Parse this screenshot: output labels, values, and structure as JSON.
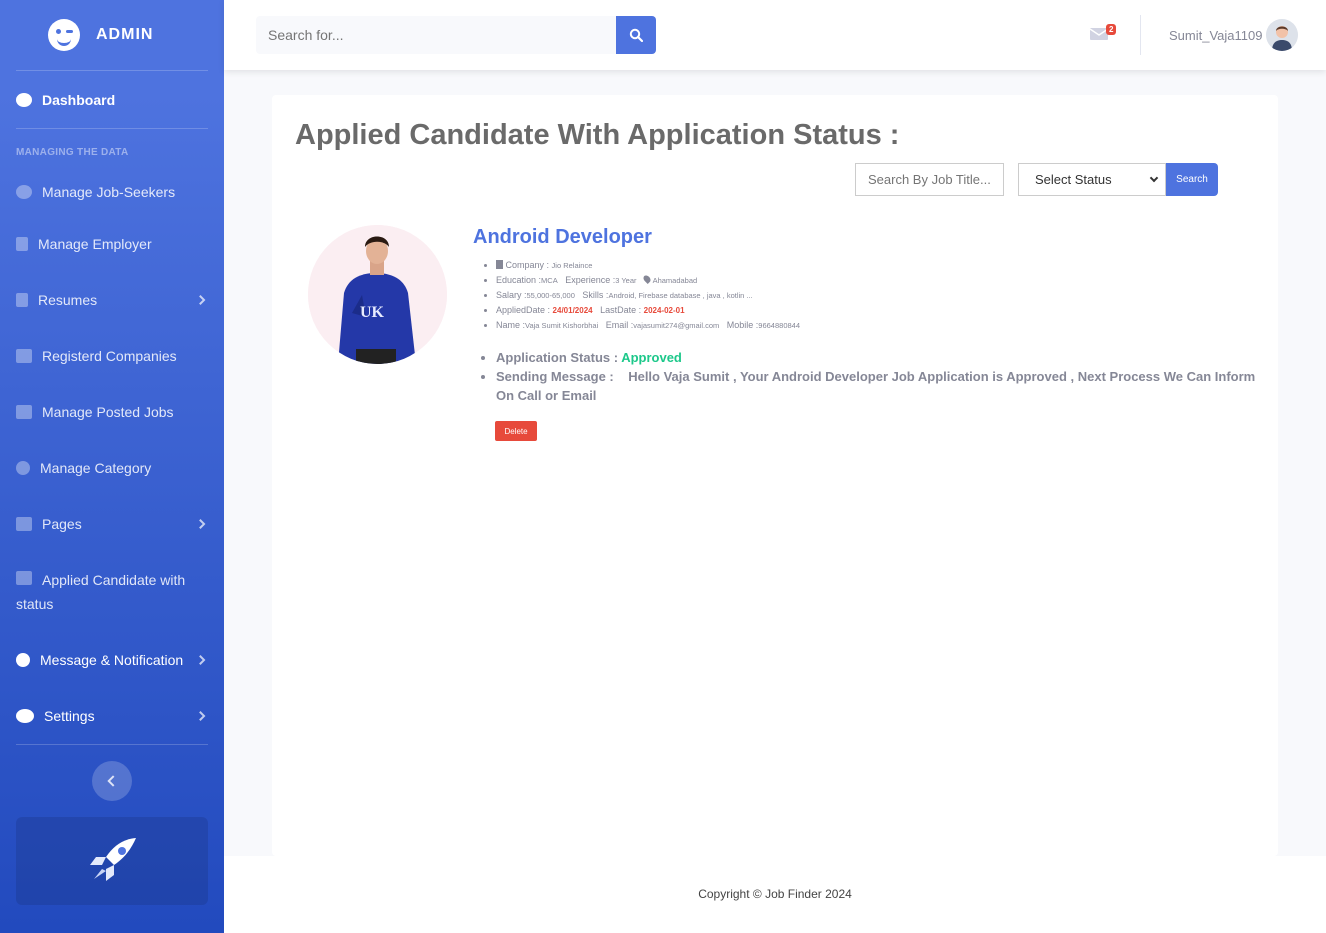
{
  "brand": {
    "name": "ADMIN"
  },
  "sidebar": {
    "dashboard": "Dashboard",
    "heading": "MANAGING THE DATA",
    "items": [
      {
        "label": "Manage Job-Seekers",
        "icon": "user-icon"
      },
      {
        "label": "Manage Employer",
        "icon": "building-icon"
      },
      {
        "label": "Resumes",
        "icon": "file-icon"
      },
      {
        "label": "Registerd Companies",
        "icon": "users-icon"
      },
      {
        "label": "Manage Posted Jobs",
        "icon": "table-icon"
      },
      {
        "label": "Manage Category",
        "icon": "smile-icon"
      },
      {
        "label": "Pages",
        "icon": "folder-icon"
      },
      {
        "label": "Applied Candidate with",
        "label2": "status",
        "icon": "book-icon"
      },
      {
        "label": "Message & Notification",
        "icon": "bell-icon"
      },
      {
        "label": "Settings",
        "icon": "gears-icon"
      }
    ]
  },
  "topbar": {
    "search_placeholder": "Search for...",
    "mail_count": "2",
    "username": "Sumit_Vaja1109"
  },
  "main": {
    "title": "Applied Candidate With Application Status :",
    "filter_placeholder": "Search By Job Title...",
    "status_select": "Select Status",
    "search_btn": "Search",
    "job": {
      "title": "Android Developer",
      "company_label": "Company : ",
      "company": "Jio Relaince",
      "education_label": "Education :",
      "education": "MCA",
      "experience_label": "Experience :",
      "experience": "3 Year",
      "location": "Ahamadabad",
      "salary_label": "Salary :",
      "salary": "55,000-65,000",
      "skills_label": "Skills :",
      "skills": "Android, Firebase database , java , kotlin ...",
      "applied_label": "AppliedDate : ",
      "applied": "24/01/2024",
      "last_label": "LastDate : ",
      "last": "2024-02-01",
      "name_label": "Name :",
      "name": "Vaja Sumit Kishorbhai",
      "email_label": "Email :",
      "email": "vajasumit274@gmail.com",
      "mobile_label": "Mobile :",
      "mobile": "9664880844",
      "status_label": "Application Status : ",
      "status": "Approved",
      "message_label": "Sending Message :",
      "message": "Hello Vaja Sumit , Your Android Developer Job Application is Approved , Next Process We Can Inform On Call or Email",
      "delete_btn": "Delete"
    }
  },
  "footer": {
    "text": "Copyright © Job Finder 2024"
  },
  "colors": {
    "primary": "#4e73df",
    "danger": "#e74a3b",
    "success": "#1cc88a"
  }
}
